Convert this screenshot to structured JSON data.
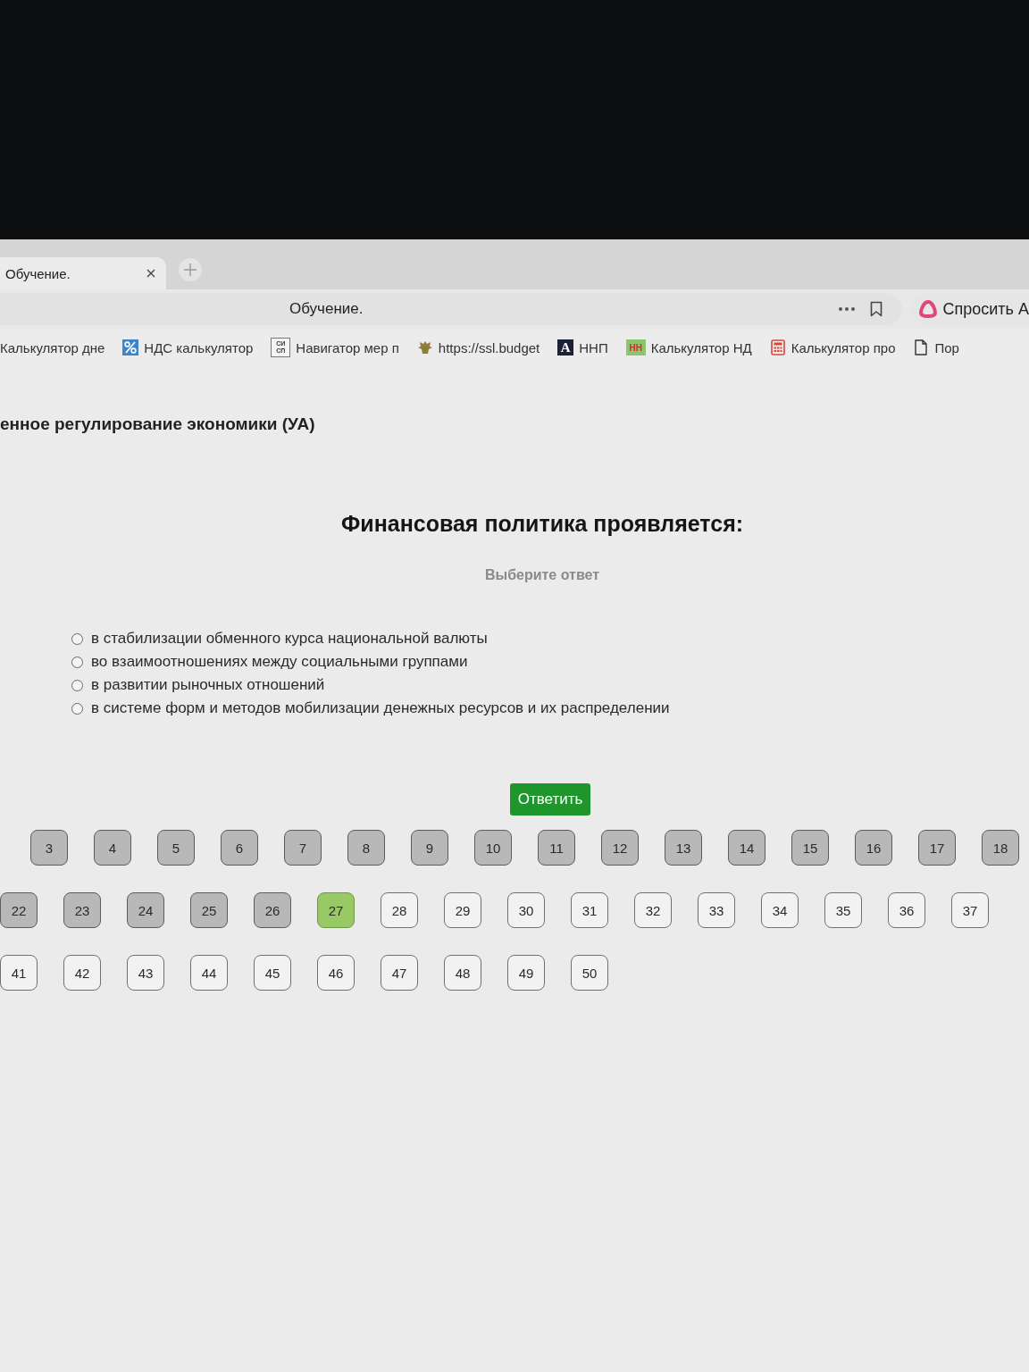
{
  "browser": {
    "tabs": [
      {
        "title": "Обучение.",
        "selected": true
      }
    ],
    "page_title": "Обучение.",
    "ask_button": "Спросить А",
    "bookmarks": [
      {
        "label": "Калькулятор дне",
        "kind": "none"
      },
      {
        "label": "НДС калькулятор",
        "kind": "percent"
      },
      {
        "label": "Навигатор мер п",
        "kind": "letters",
        "icon_text": "СИ СП"
      },
      {
        "label": "https://ssl.budget",
        "kind": "emblem"
      },
      {
        "label": "ННП",
        "kind": "dark-letter",
        "icon_text": "A"
      },
      {
        "label": "Калькулятор НД",
        "kind": "green-letters",
        "icon_text": "НН"
      },
      {
        "label": "Калькулятор про",
        "kind": "calculator"
      },
      {
        "label": "Пор",
        "kind": "page"
      }
    ]
  },
  "course_title": "енное регулирование экономики (УА)",
  "question": {
    "title": "Финансовая политика проявляется:",
    "hint": "Выберите ответ",
    "options": [
      {
        "text": "в стабилизации обменного курса национальной валюты",
        "selected": false
      },
      {
        "text": "во взаимоотношениях между социальными группами",
        "selected": false
      },
      {
        "text": "в развитии рыночных отношений",
        "selected": false
      },
      {
        "text": "в системе форм и методов мобилизации денежных ресурсов и их распределении",
        "selected": false
      }
    ]
  },
  "submit_button": "Ответить",
  "question_nav": {
    "rows": [
      [
        {
          "number": "3",
          "answered": true,
          "selected": false
        },
        {
          "number": "4",
          "answered": true,
          "selected": false
        },
        {
          "number": "5",
          "answered": true,
          "selected": false
        },
        {
          "number": "6",
          "answered": true,
          "selected": false
        },
        {
          "number": "7",
          "answered": true,
          "selected": false
        },
        {
          "number": "8",
          "answered": true,
          "selected": false
        },
        {
          "number": "9",
          "answered": true,
          "selected": false
        },
        {
          "number": "10",
          "answered": true,
          "selected": false
        },
        {
          "number": "11",
          "answered": true,
          "selected": false
        },
        {
          "number": "12",
          "answered": true,
          "selected": false
        },
        {
          "number": "13",
          "answered": true,
          "selected": false
        },
        {
          "number": "14",
          "answered": true,
          "selected": false
        },
        {
          "number": "15",
          "answered": true,
          "selected": false
        },
        {
          "number": "16",
          "answered": true,
          "selected": false
        },
        {
          "number": "17",
          "answered": true,
          "selected": false
        },
        {
          "number": "18",
          "answered": true,
          "selected": false
        }
      ],
      [
        {
          "number": "22",
          "answered": true,
          "selected": false
        },
        {
          "number": "23",
          "answered": true,
          "selected": false
        },
        {
          "number": "24",
          "answered": true,
          "selected": false
        },
        {
          "number": "25",
          "answered": true,
          "selected": false
        },
        {
          "number": "26",
          "answered": true,
          "selected": false
        },
        {
          "number": "27",
          "answered": false,
          "selected": true
        },
        {
          "number": "28",
          "answered": false,
          "selected": false
        },
        {
          "number": "29",
          "answered": false,
          "selected": false
        },
        {
          "number": "30",
          "answered": false,
          "selected": false
        },
        {
          "number": "31",
          "answered": false,
          "selected": false
        },
        {
          "number": "32",
          "answered": false,
          "selected": false
        },
        {
          "number": "33",
          "answered": false,
          "selected": false
        },
        {
          "number": "34",
          "answered": false,
          "selected": false
        },
        {
          "number": "35",
          "answered": false,
          "selected": false
        },
        {
          "number": "36",
          "answered": false,
          "selected": false
        },
        {
          "number": "37",
          "answered": false,
          "selected": false
        }
      ],
      [
        {
          "number": "41",
          "answered": false,
          "selected": false
        },
        {
          "number": "42",
          "answered": false,
          "selected": false
        },
        {
          "number": "43",
          "answered": false,
          "selected": false
        },
        {
          "number": "44",
          "answered": false,
          "selected": false
        },
        {
          "number": "45",
          "answered": false,
          "selected": false
        },
        {
          "number": "46",
          "answered": false,
          "selected": false
        },
        {
          "number": "47",
          "answered": false,
          "selected": false
        },
        {
          "number": "48",
          "answered": false,
          "selected": false
        },
        {
          "number": "49",
          "answered": false,
          "selected": false
        },
        {
          "number": "50",
          "answered": false,
          "selected": false
        }
      ]
    ]
  }
}
